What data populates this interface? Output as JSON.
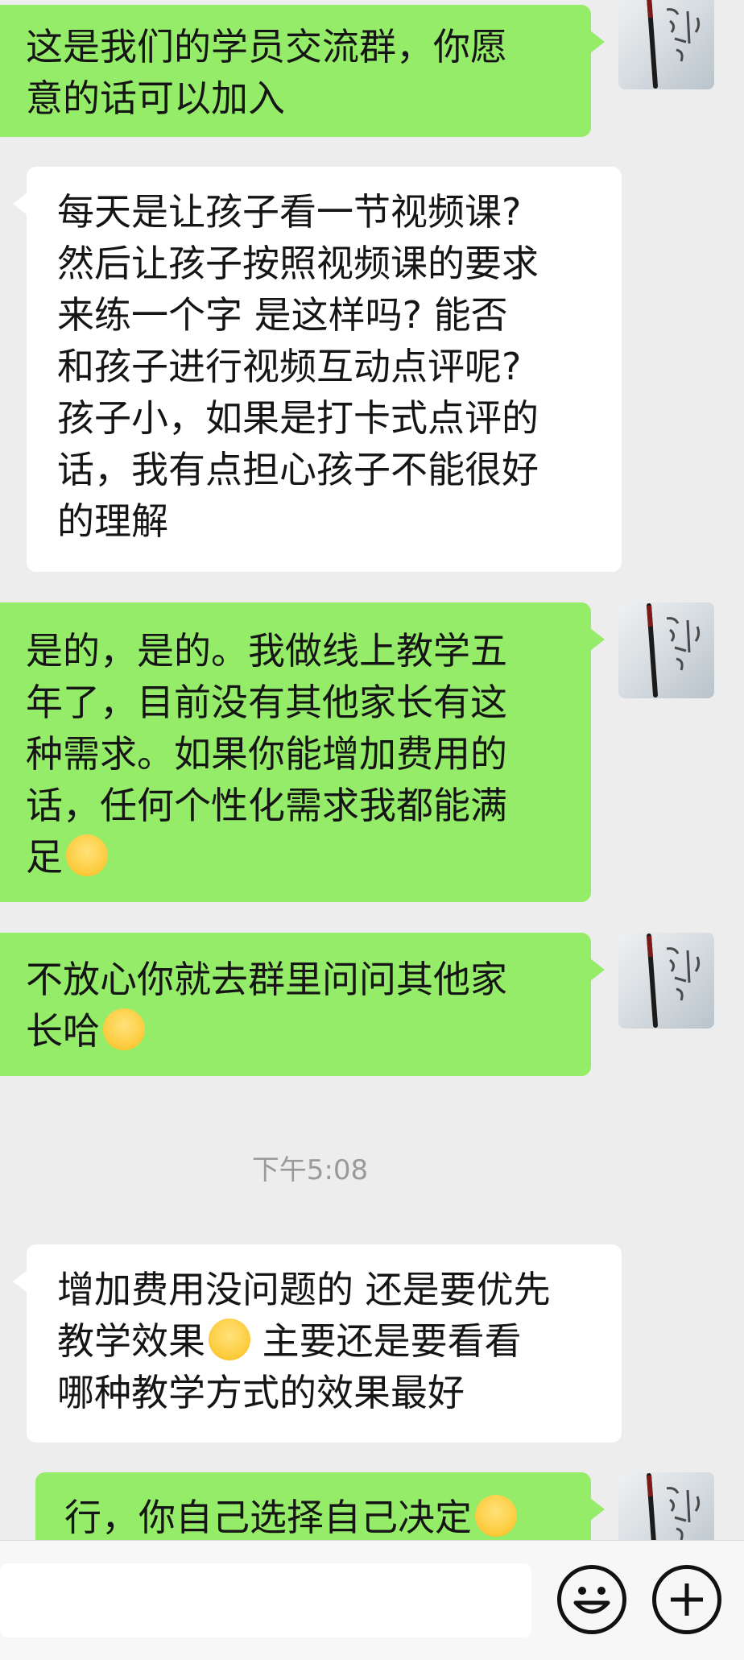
{
  "messages": [
    {
      "side": "sent",
      "text": "这是我们的学员交流群，你愿\n意的话可以加入"
    },
    {
      "side": "recv",
      "text": "每天是让孩子看一节视频课?\n然后让孩子按照视频课的要求\n来练一个字  是这样吗?  能否\n和孩子进行视频互动点评呢?\n孩子小，如果是打卡式点评的\n话，我有点担心孩子不能很好\n的理解"
    },
    {
      "side": "sent",
      "text": "是的，是的。我做线上教学五\n年了，目前没有其他家长有这\n种需求。如果你能增加费用的\n话，任何个性化需求我都能满\n足",
      "emoji": "smile-emoji"
    },
    {
      "side": "sent",
      "text": "不放心你就去群里问问其他家\n长哈",
      "emoji": "smile-emoji"
    },
    {
      "side": "recv",
      "text": "增加费用没问题的  还是要优先\n教学效果",
      "emoji": "grin-emoji",
      "text2": "   主要还是要看看\n哪种教学方式的效果最好"
    },
    {
      "side": "sent",
      "text": "行，你自己选择自己决定",
      "emoji": "smile-emoji"
    }
  ],
  "timestamp": "下午5:08",
  "avatar_calligraphy": "修心养性",
  "bottom_bar": {
    "emoji_button_icon": "emoji-face-icon",
    "add_button_icon": "plus-circle-icon"
  },
  "colors": {
    "sent_bubble": "#95ec69",
    "received_bubble": "#ffffff",
    "background": "#ededed"
  }
}
